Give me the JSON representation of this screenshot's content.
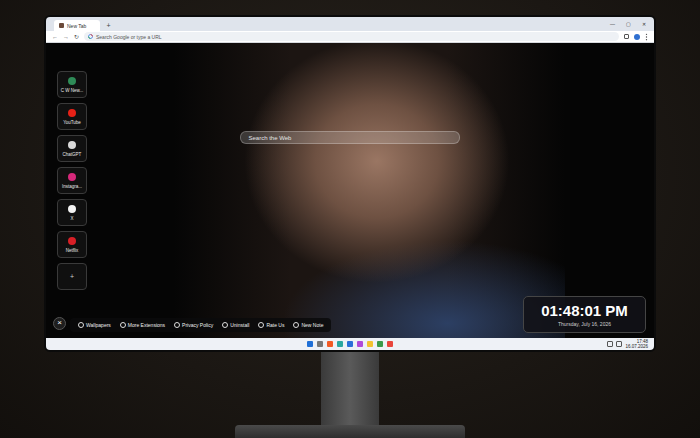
{
  "browser": {
    "tabs": [
      {
        "label": "New Tab",
        "selected": true
      }
    ],
    "new_tab_button": "+",
    "window_controls": [
      "—",
      "▢",
      "✕"
    ],
    "nav_buttons": [
      "←",
      "→",
      "↻"
    ],
    "omnibox": {
      "placeholder": "Search Google or type a URL"
    }
  },
  "shortcuts": [
    {
      "label": "C W New...",
      "color": "#2e8b57"
    },
    {
      "label": "YouTube",
      "color": "#e62117"
    },
    {
      "label": "ChatGPT",
      "color": "#d9d9d9"
    },
    {
      "label": "Instagra...",
      "color": "#d6287a"
    },
    {
      "label": "X",
      "color": "#f2f2f2"
    },
    {
      "label": "Netflix",
      "color": "#d81f26"
    }
  ],
  "add_shortcut": "+",
  "search": {
    "placeholder": "Search the Web"
  },
  "close_button": "×",
  "footer_links": [
    "Wallpapers",
    "More Extensions",
    "Privacy Policy",
    "Uninstall",
    "Rate Us",
    "New Note"
  ],
  "clock": {
    "time": "01:48:01 PM",
    "date": "Thursday, July 16, 2026"
  },
  "taskbar": {
    "time": "17:48",
    "date": "16.07.2026"
  }
}
